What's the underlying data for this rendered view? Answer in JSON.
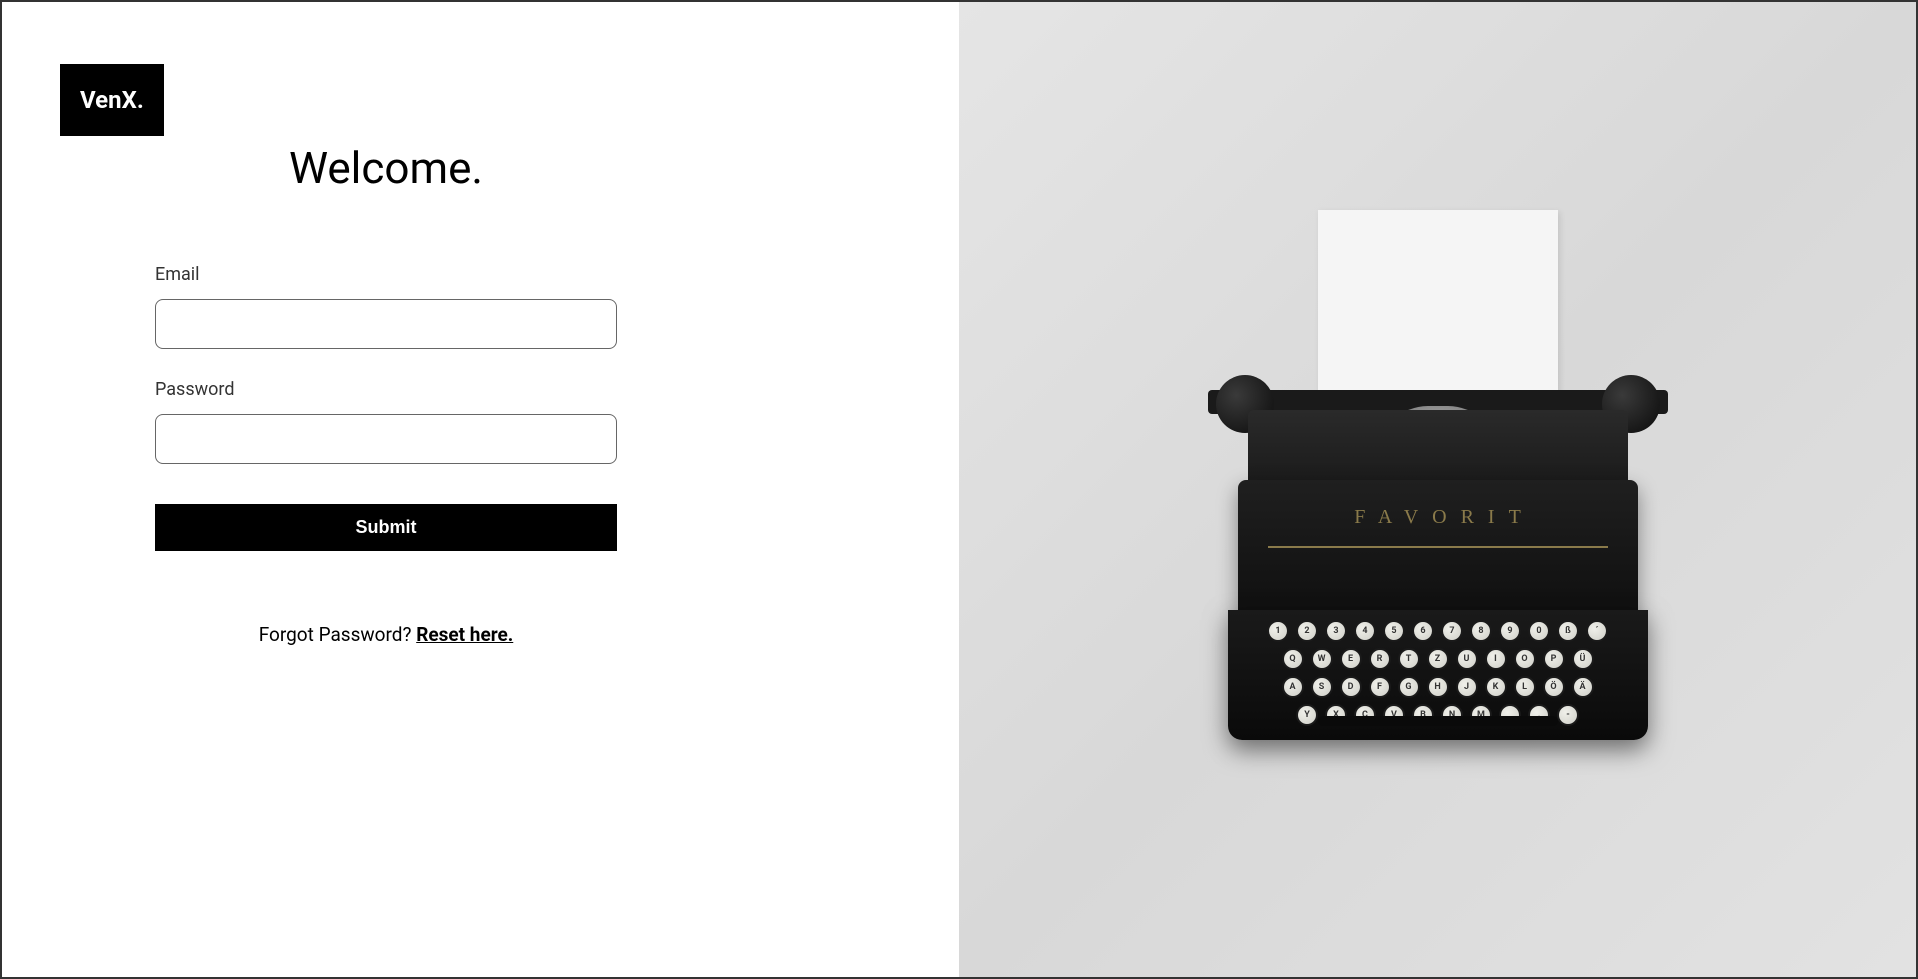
{
  "brand": {
    "logo_text": "VenX."
  },
  "login": {
    "title": "Welcome.",
    "email_label": "Email",
    "email_value": "",
    "password_label": "Password",
    "password_value": "",
    "submit_label": "Submit",
    "forgot_text": "Forgot Password? ",
    "reset_link_text": "Reset here."
  },
  "illustration": {
    "brand_label": "FAVORIT",
    "key_rows": [
      [
        "1",
        "2",
        "3",
        "4",
        "5",
        "6",
        "7",
        "8",
        "9",
        "0",
        "ß",
        "´"
      ],
      [
        "Q",
        "W",
        "E",
        "R",
        "T",
        "Z",
        "U",
        "I",
        "O",
        "P",
        "Ü"
      ],
      [
        "A",
        "S",
        "D",
        "F",
        "G",
        "H",
        "J",
        "K",
        "L",
        "Ö",
        "Ä"
      ],
      [
        "Y",
        "X",
        "C",
        "V",
        "B",
        "N",
        "M",
        ",",
        ".",
        "-"
      ]
    ]
  }
}
